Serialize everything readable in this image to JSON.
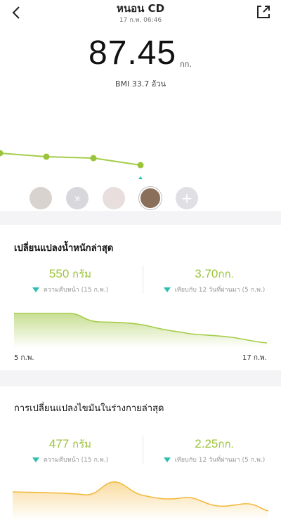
{
  "header": {
    "title": "หนอน CD",
    "datetime": "17 ก.พ. 06:46"
  },
  "weight": {
    "value": "87.45",
    "unit": "กก.",
    "bmi_text": "BMI 33.7  อ้วน"
  },
  "avatars": [
    {
      "name": "photo-1",
      "initial": ""
    },
    {
      "name": "photo-2",
      "initial": "ห"
    },
    {
      "name": "photo-3",
      "initial": ""
    },
    {
      "name": "photo-4",
      "initial": ""
    },
    {
      "name": "add",
      "initial": "+"
    }
  ],
  "weight_card": {
    "title": "เปลี่ยนแปลงน้ำหนักล่าสุด",
    "left_value": "550",
    "left_unit": "กรัม",
    "left_label": "ความคืบหน้า (15 ก.พ.)",
    "right_value": "3.70",
    "right_unit": "กก.",
    "right_label": "เทียบกับ 12 วันที่ผ่านมา (5 ก.พ.)",
    "start_date": "5 ก.พ.",
    "end_date": "17 ก.พ."
  },
  "fat_card": {
    "title": "การเปลี่ยนแปลงไขมันในร่างกายล่าสุด",
    "left_value": "477",
    "left_unit": "กรัม",
    "left_label": "ความคืบหน้า (15 ก.พ.)",
    "right_value": "2.25",
    "right_unit": "กก.",
    "right_label": "เทียบกับ 12 วันที่ผ่านมา (5 ก.พ.)"
  },
  "colors": {
    "accent_green": "#9bc43a",
    "indicator_teal": "#2bbfb0",
    "fat_orange": "#f3b940"
  }
}
